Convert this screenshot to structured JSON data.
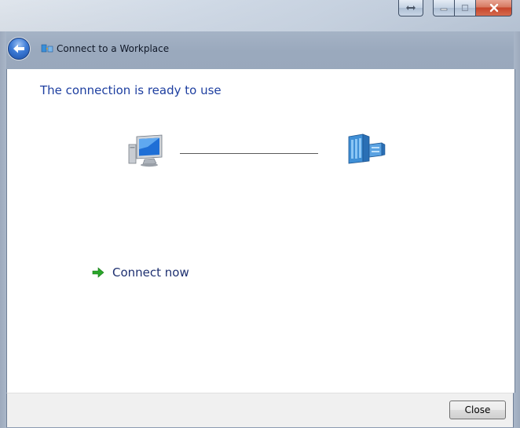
{
  "window": {
    "title": "Connect to a Workplace"
  },
  "content": {
    "heading": "The connection is ready to use",
    "connect_now_label": "Connect now"
  },
  "footer": {
    "close_label": "Close"
  },
  "icons": {
    "back": "back-arrow-icon",
    "title": "network-connection-icon",
    "computer": "computer-icon",
    "server": "server-icon",
    "connect": "green-arrow-icon"
  },
  "colors": {
    "heading": "#1e3fa0",
    "link": "#1e3070",
    "close_button": "#c6452b"
  }
}
